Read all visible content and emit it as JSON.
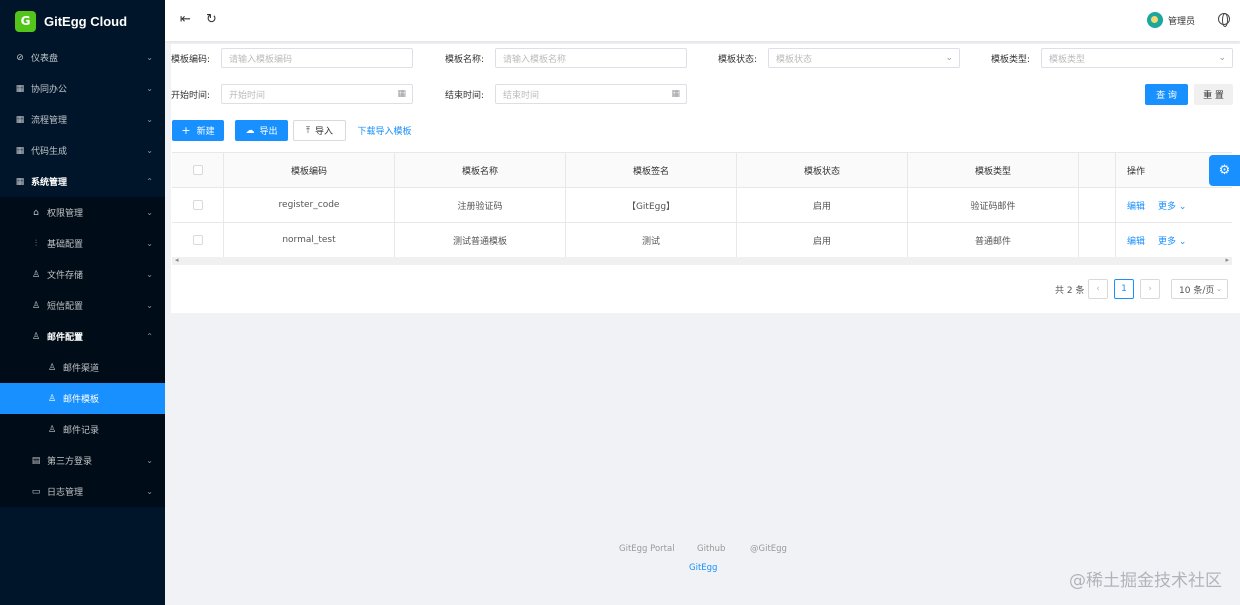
{
  "app": {
    "logo_text": "GitEgg Cloud",
    "logo_badge": "G"
  },
  "sidebar": {
    "items": [
      {
        "label": "仪表盘",
        "icon": "dashboard-icon",
        "glyph": "⊘",
        "level": 1,
        "arrow": "⌄"
      },
      {
        "label": "协同办公",
        "icon": "grid-icon",
        "glyph": "▦",
        "level": 1,
        "arrow": "⌄"
      },
      {
        "label": "流程管理",
        "icon": "grid-icon",
        "glyph": "▦",
        "level": 1,
        "arrow": "⌄"
      },
      {
        "label": "代码生成",
        "icon": "grid-icon",
        "glyph": "▦",
        "level": 1,
        "arrow": "⌄"
      },
      {
        "label": "系统管理",
        "icon": "grid-icon",
        "glyph": "▦",
        "level": 1,
        "arrow": "⌃",
        "open": true
      },
      {
        "label": "权限管理",
        "icon": "lock-icon",
        "glyph": "⌂",
        "level": 2,
        "arrow": "⌄"
      },
      {
        "label": "基础配置",
        "icon": "sliders-icon",
        "glyph": "⫶",
        "level": 2,
        "arrow": "⌄"
      },
      {
        "label": "文件存储",
        "icon": "user-icon",
        "glyph": "♙",
        "level": 2,
        "arrow": "⌄"
      },
      {
        "label": "短信配置",
        "icon": "user-icon",
        "glyph": "♙",
        "level": 2,
        "arrow": "⌄"
      },
      {
        "label": "邮件配置",
        "icon": "user-icon",
        "glyph": "♙",
        "level": 2,
        "arrow": "⌃",
        "open": true
      },
      {
        "label": "邮件渠道",
        "icon": "user-icon",
        "glyph": "♙",
        "level": 3,
        "arrow": ""
      },
      {
        "label": "邮件模板",
        "icon": "user-icon",
        "glyph": "♙",
        "level": 3,
        "arrow": "",
        "active": true
      },
      {
        "label": "邮件记录",
        "icon": "user-icon",
        "glyph": "♙",
        "level": 3,
        "arrow": ""
      },
      {
        "label": "第三方登录",
        "icon": "calendar-icon",
        "glyph": "▤",
        "level": 2,
        "arrow": "⌄"
      },
      {
        "label": "日志管理",
        "icon": "log-icon",
        "glyph": "▭",
        "level": 2,
        "arrow": "⌄"
      }
    ]
  },
  "header": {
    "username": "管理员",
    "collapse_glyph": "⇤",
    "refresh_glyph": "↻"
  },
  "search": {
    "template_code_label": "模板编码:",
    "template_code_placeholder": "请输入模板编码",
    "template_name_label": "模板名称:",
    "template_name_placeholder": "请输入模板名称",
    "template_status_label": "模板状态:",
    "template_status_placeholder": "模板状态",
    "template_type_label": "模板类型:",
    "template_type_placeholder": "模板类型",
    "start_time_label": "开始时间:",
    "start_time_placeholder": "开始时间",
    "end_time_label": "结束时间:",
    "end_time_placeholder": "结束时间",
    "query_label": "查 询",
    "reset_label": "重 置"
  },
  "toolbar": {
    "new_label": "新建",
    "export_label": "导出",
    "import_label": "导入",
    "download_label": "下载导入模板"
  },
  "table": {
    "columns": [
      "模板编码",
      "模板名称",
      "模板签名",
      "模板状态",
      "模板类型",
      "",
      "操作"
    ],
    "rows": [
      {
        "code": "register_code",
        "name": "注册验证码",
        "sign": "【GitEgg】",
        "status": "启用",
        "type": "验证码邮件",
        "edit": "编辑",
        "more": "更多 ⌄"
      },
      {
        "code": "normal_test",
        "name": "测试普通模板",
        "sign": "测试",
        "status": "启用",
        "type": "普通邮件",
        "edit": "编辑",
        "more": "更多 ⌄"
      }
    ]
  },
  "pagination": {
    "total": "共 2 条",
    "current": "1",
    "page_size": "10 条/页",
    "prev": "‹",
    "next": "›"
  },
  "footer": {
    "portal": "GitEgg Portal",
    "github": "Github",
    "copyright": "@GitEgg",
    "brand": "GitEgg"
  },
  "watermark": "@稀土掘金技术社区",
  "colors": {
    "primary": "#1890ff",
    "sidebar": "#001529",
    "submenu": "#000c17",
    "logo": "#52c41a"
  }
}
